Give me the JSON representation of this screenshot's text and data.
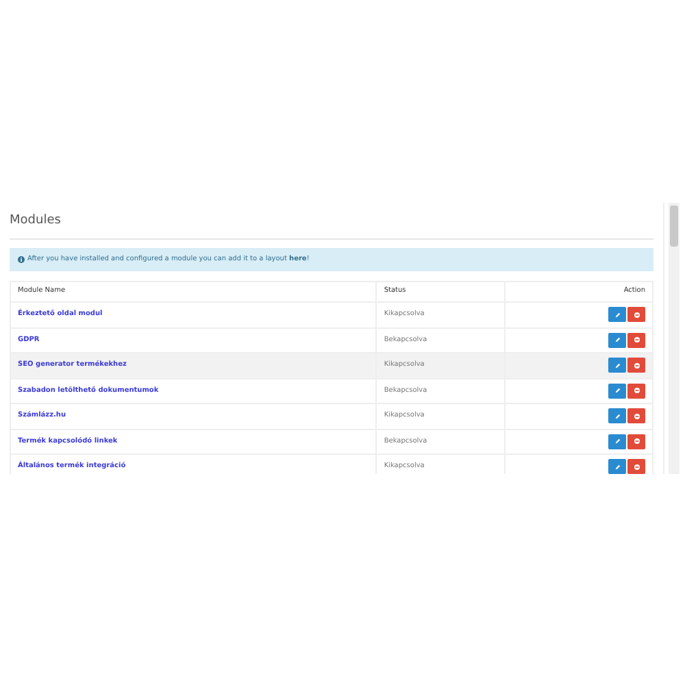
{
  "panel": {
    "title": "Modules",
    "alert": {
      "text": "After you have installed and configured a module you can add it to a layout **here**!"
    }
  },
  "table": {
    "columns": [
      "Module Name",
      "Status",
      "Action"
    ],
    "rows": [
      {
        "name": "Érkeztető oldal modul",
        "status": "Kikapcsolva",
        "highlighted": false
      },
      {
        "name": "GDPR",
        "status": "Bekapcsolva",
        "highlighted": false
      },
      {
        "name": "SEO generator termékekhez",
        "status": "Kikapcsolva",
        "highlighted": true
      },
      {
        "name": "Szabadon letölthető dokumentumok",
        "status": "Bekapcsolva",
        "highlighted": false
      },
      {
        "name": "Számlázz.hu",
        "status": "Kikapcsolva",
        "highlighted": false
      },
      {
        "name": "Termék kapcsolódó linkek",
        "status": "Bekapcsolva",
        "highlighted": false
      },
      {
        "name": "Általános termék integráció",
        "status": "Kikapcsolva",
        "highlighted": false
      }
    ]
  }
}
